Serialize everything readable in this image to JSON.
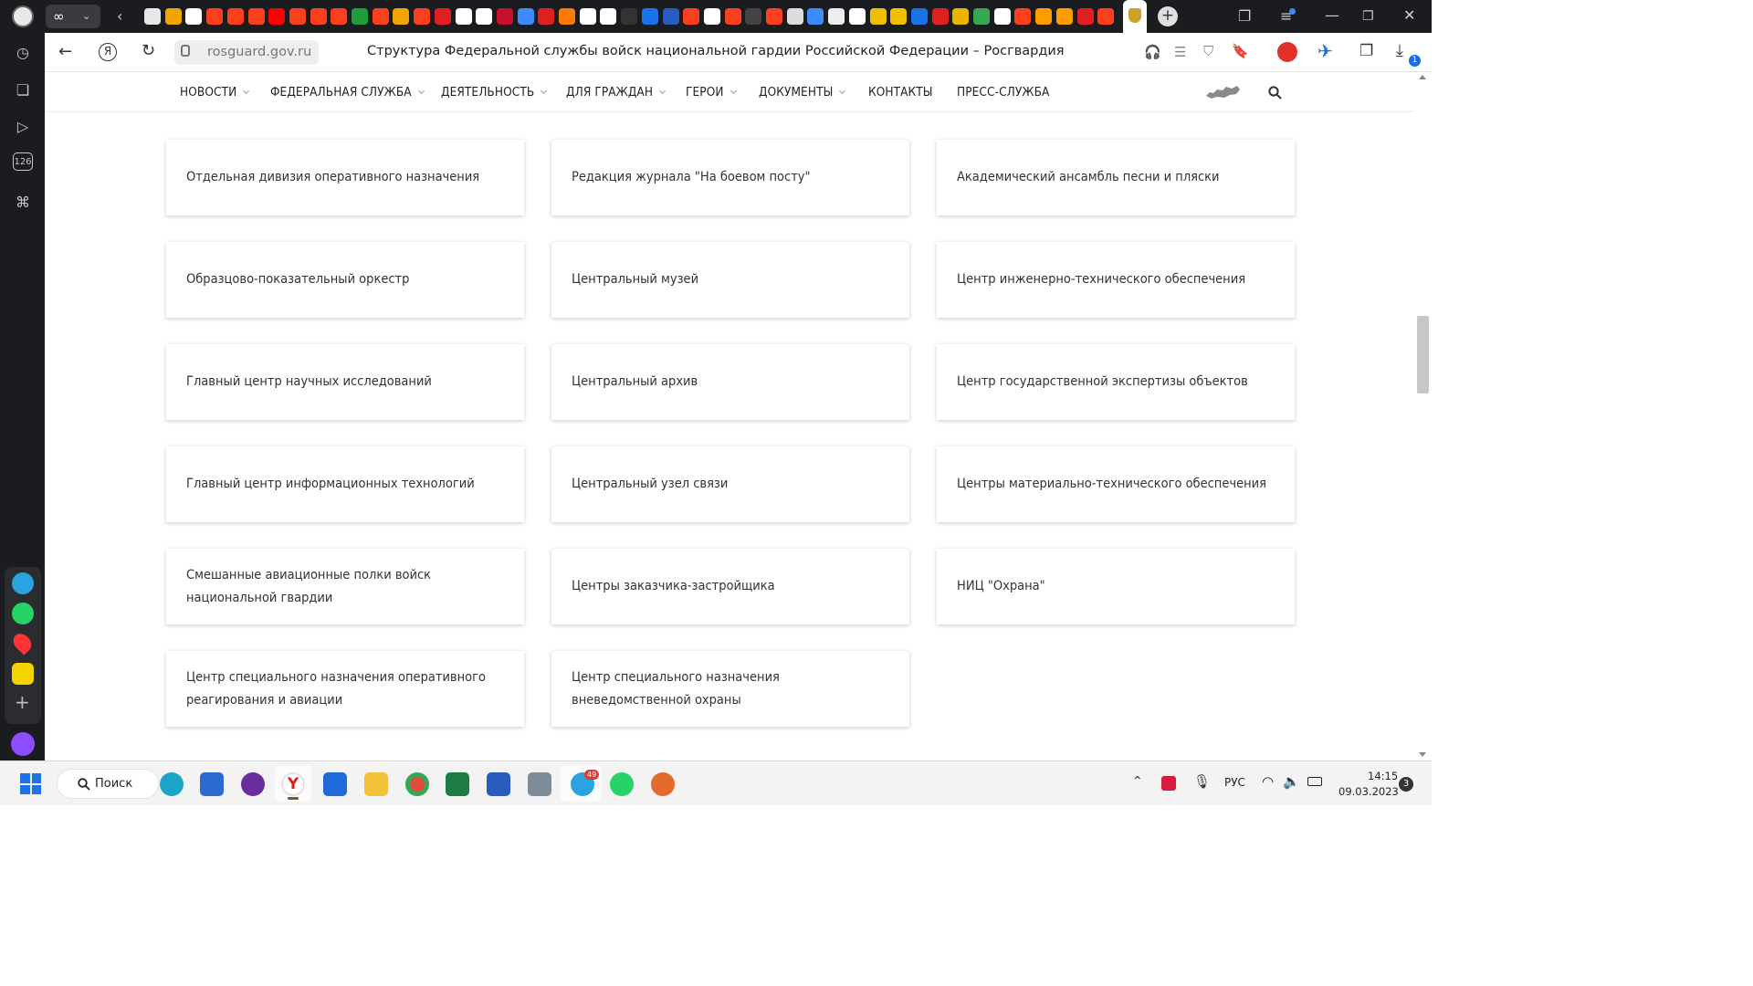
{
  "browser": {
    "url": "rosguard.gov.ru",
    "page_title": "Структура Федеральной службы войск национальной гардии Российской Федерации – Росгвардия",
    "downloads_badge": "1"
  },
  "site_nav": {
    "items": [
      {
        "label": "НОВОСТИ",
        "dropdown": true
      },
      {
        "label": "ФЕДЕРАЛЬНАЯ СЛУЖБА",
        "dropdown": true
      },
      {
        "label": "ДЕЯТЕЛЬНОСТЬ",
        "dropdown": true
      },
      {
        "label": "ДЛЯ ГРАЖДАН",
        "dropdown": true
      },
      {
        "label": "ГЕРОИ",
        "dropdown": true
      },
      {
        "label": "ДОКУМЕНТЫ",
        "dropdown": true
      },
      {
        "label": "КОНТАКТЫ",
        "dropdown": false
      },
      {
        "label": "ПРЕСС-СЛУЖБА",
        "dropdown": false
      }
    ]
  },
  "cards": [
    "Отдельная дивизия оперативного назначения",
    "Редакция журнала \"На боевом посту\"",
    "Академический ансамбль песни и пляски",
    "Образцово-показательный оркестр",
    "Центральный музей",
    "Центр инженерно-технического обеспечения",
    "Главный центр научных исследований",
    "Центральный архив",
    "Центр государственной экспертизы объектов",
    "Главный центр информационных технологий",
    "Центральный узел связи",
    "Центры материально-технического обеспечения",
    "Смешанные авиационные полки войск национальной гвардии",
    "Центры заказчика-застройщика",
    "НИЦ \"Охрана\"",
    "Центр специального назначения оперативного реагирования и авиации",
    "Центр специального назначения вневедомственной охраны"
  ],
  "sidebar": {
    "counter": "126"
  },
  "taskbar": {
    "search_label": "Поиск",
    "telegram_badge": "49",
    "language": "РУС",
    "time": "14:15",
    "date": "09.03.2023",
    "notifications": "3"
  },
  "colors": {
    "chrome_dark": "#1b1c1f",
    "yandex_red": "#fc3f1d",
    "taskbar": "#f3f3f3",
    "text": "#333333"
  }
}
